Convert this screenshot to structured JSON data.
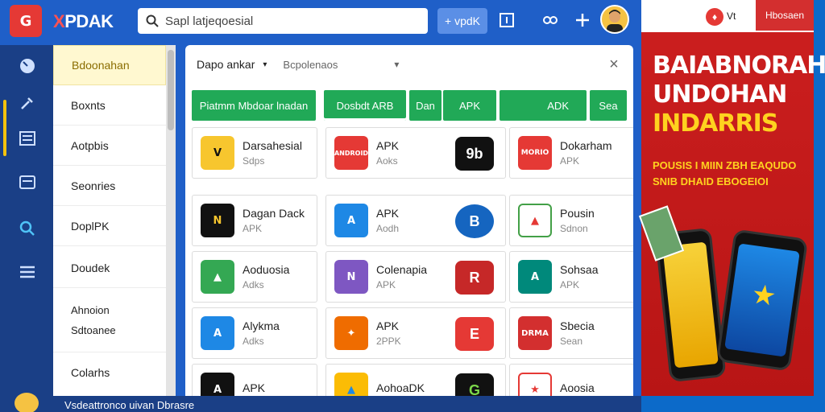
{
  "header": {
    "logo_text": "G",
    "brand_prefix": "X",
    "brand_rest": "PDAK",
    "search_placeholder": "Sapl latjeqoesial",
    "primary_button": "+ vpdK"
  },
  "rail": {
    "icons": [
      "dashboard-icon",
      "tools-icon",
      "list-icon",
      "calendar-icon",
      "search-icon",
      "menu-icon"
    ]
  },
  "sidebar": {
    "items": [
      {
        "label": "Bdoonahan"
      },
      {
        "label": "Boxnts"
      },
      {
        "label": "Aotpbis"
      },
      {
        "label": "Seonries"
      },
      {
        "label": "DoplPK"
      },
      {
        "label": "Doudek"
      },
      {
        "label": "Ahnoion",
        "label2": "Sdtoanee"
      },
      {
        "label": "Colarhs"
      }
    ]
  },
  "main": {
    "title": "Dapo ankar",
    "subtitle": "Bcpolenaos",
    "tabs": [
      {
        "label": "Piatmm Mbdoar lnadan"
      },
      {
        "label": "Dosbdt ARB"
      },
      {
        "label": "Dan"
      },
      {
        "label": "APK"
      },
      {
        "label": "ADK"
      },
      {
        "label": "Sea"
      }
    ],
    "cards": [
      {
        "name": "Darsahesial",
        "sub": "Sdps",
        "color": "#f7c62e",
        "icon_text": "V"
      },
      {
        "name": "APK",
        "sub": "Aoks",
        "color": "#e53935",
        "icon_text": "ANDROID",
        "extra_text": "9b",
        "extra_color": "#111111"
      },
      {
        "name": "Dokarham",
        "sub": "APK",
        "color": "#e53935",
        "icon_text": "MORIO"
      },
      {
        "name": "Dagan Dack",
        "sub": "APK",
        "color": "#111111",
        "icon_text": "N"
      },
      {
        "name": "APK",
        "sub": "Aodh",
        "color": "#1e88e5",
        "icon_text": "A",
        "extra_text": "B",
        "extra_color": "#1565c0"
      },
      {
        "name": "Pousin",
        "sub": "Sdnon",
        "color": "#43a047",
        "icon_text": "▲"
      },
      {
        "name": "Aoduosia",
        "sub": "Adks",
        "color": "#34a853",
        "icon_text": "▲"
      },
      {
        "name": "Colenapia",
        "sub": "APK",
        "color": "#7e57c2",
        "icon_text": "N",
        "extra_text": "R",
        "extra_color": "#c62828"
      },
      {
        "name": "Sohsaa",
        "sub": "APK",
        "color": "#00897b",
        "icon_text": "A"
      },
      {
        "name": "Alykma",
        "sub": "Adks",
        "color": "#1e88e5",
        "icon_text": "A"
      },
      {
        "name": "APK",
        "sub": "2PPK",
        "color": "#ef6c00",
        "icon_text": "✦",
        "extra_text": "E",
        "extra_color": "#e53935"
      },
      {
        "name": "Sbecia",
        "sub": "Sean",
        "color": "#d32f2f",
        "icon_text": "DRMA"
      },
      {
        "name": "APK",
        "sub": "",
        "color": "#111111",
        "icon_text": "A"
      },
      {
        "name": "AohoaDK",
        "sub": "",
        "color": "#fbbc05",
        "icon_text": "▲",
        "extra_text": "G",
        "extra_color": "#111111"
      },
      {
        "name": "Aoosia",
        "sub": "",
        "color": "#e53935",
        "icon_text": "★"
      }
    ]
  },
  "ad": {
    "brand": "Vt",
    "badge": "Hbosaen",
    "headline_line1": "BAIABNORAH",
    "headline_line2": "UNDOHAN",
    "headline_line3": "INDARRIS",
    "subline1": "POUSIS I MIIN ZBH EAQUDO",
    "subline2": "SNIB DHAID EBOGEIOI"
  },
  "footer": {
    "text": "Vsdeattronco uivan Dbrasre"
  },
  "colors": {
    "primary_blue": "#1f5fc8",
    "rail_blue": "#1a3f86",
    "tab_green": "#21a957",
    "ad_red": "#cc1f1f",
    "ad_yellow": "#ffd21f"
  }
}
